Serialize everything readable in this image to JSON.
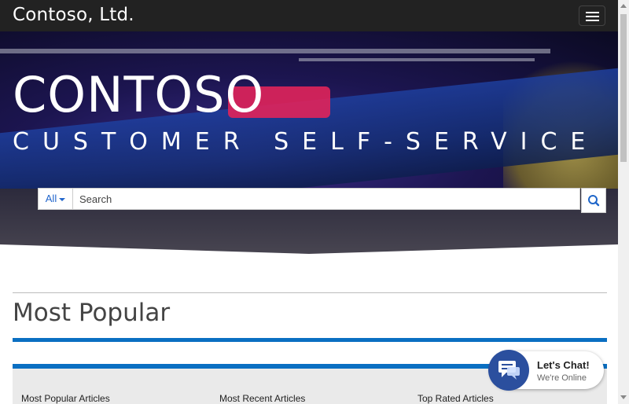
{
  "header": {
    "brand": "Contoso, Ltd.",
    "menu_icon": "hamburger-icon"
  },
  "hero": {
    "title": "CONTOSO",
    "subtitle": "CUSTOMER SELF-SERVICE",
    "search": {
      "filter_label": "All",
      "placeholder": "Search",
      "button_icon": "search-icon"
    }
  },
  "section": {
    "title": "Most Popular",
    "columns": [
      "Most Popular Articles",
      "Most Recent Articles",
      "Top Rated Articles"
    ]
  },
  "chat": {
    "title": "Let's Chat!",
    "status": "We're Online",
    "icon": "chat-icon"
  },
  "colors": {
    "topbar": "#222222",
    "accent": "#0a6fc2",
    "chat_bubble": "#2b4f9e"
  }
}
